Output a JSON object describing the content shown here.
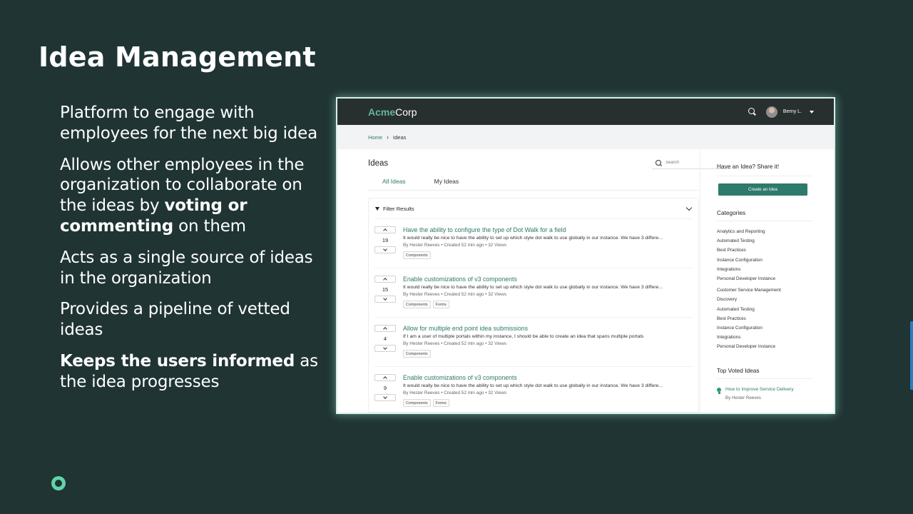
{
  "slide": {
    "title": "Idea Management",
    "bullets": [
      {
        "text": "Platform to engage with employees for the next big idea"
      },
      {
        "pre": "Allows other employees in the organization to collaborate on the ideas by ",
        "bold": "voting or commenting",
        "post": " on them"
      },
      {
        "text": "Acts as a single source of ideas in the organization"
      },
      {
        "text": "Provides a pipeline of vetted ideas"
      },
      {
        "bold": "Keeps the users informed",
        "post": " as the idea progresses"
      }
    ],
    "colors": {
      "background": "#1f3433",
      "accent": "#2e7a6b",
      "logo_accent": "#61b49a"
    }
  },
  "app": {
    "logo_part1": "Acme",
    "logo_part2": "Corp",
    "user_name": "Berny L.",
    "icons": {
      "search": "search-icon",
      "user_menu": "chevron-down-icon"
    }
  },
  "breadcrumb": {
    "home": "Home",
    "current": "Ideas"
  },
  "main": {
    "title": "Ideas",
    "search_placeholder": "Search",
    "tabs": [
      {
        "label": "All Ideas",
        "active": true
      },
      {
        "label": "My Ideas",
        "active": false
      }
    ],
    "filter_label": "Filter Results",
    "ideas": [
      {
        "votes": "19",
        "title": "Have the ability to configure the type of Dot Walk for a field",
        "desc": "It would really be nice to have the ability to set up which style dot walk to use globally in our instance. We have 3 differe...",
        "author": "By Hester Reeves",
        "created": "Created 52 min ago",
        "views": "32 Views",
        "tags": [
          "Components"
        ]
      },
      {
        "votes": "15",
        "title": "Enable customizations of v3 components",
        "desc": "It would really be nice to have the ability to set up which style dot walk to use globally in our instance. We have 3 differe...",
        "author": "By Hester Reeves",
        "created": "Created 52 min ago",
        "views": "32 Views",
        "tags": [
          "Components",
          "Forms"
        ]
      },
      {
        "votes": "4",
        "title": "Allow for multiple end point idea submissions",
        "desc": "If I am a user of multiple portals within my instance, I should be able to create an idea that spans multiple portals",
        "author": "By Hester Reeves",
        "created": "Created 52 min ago",
        "views": "32 Views",
        "tags": [
          "Components"
        ]
      },
      {
        "votes": "9",
        "title": "Enable customizations of v3 components",
        "desc": "It would really be nice to have the ability to set up which style dot walk to use globally in our instance. We have 3 differe...",
        "author": "By Hester Reeves",
        "created": "Created 52 min ago",
        "views": "32 Views",
        "tags": [
          "Components",
          "Forms"
        ]
      }
    ]
  },
  "sidebar": {
    "share_title": "Have an Idea? Share it!",
    "create_button": "Create an Idea",
    "categories_title": "Categories",
    "categories": [
      "Analytics and Reporting",
      "Automated Testing",
      "Best Practices",
      "Instance Configuration",
      "Integrations",
      "Personal Developer Instance",
      "Customer Service Management",
      "Discovery",
      "Automated Testing",
      "Best Practices",
      "Instance Configuration",
      "Integrations",
      "Personal Developer Instance"
    ],
    "top_voted_title": "Top Voted Ideas",
    "top_voted": [
      {
        "title": "How to Improve Service Delivery",
        "author": "By Hester Reeves"
      }
    ]
  }
}
